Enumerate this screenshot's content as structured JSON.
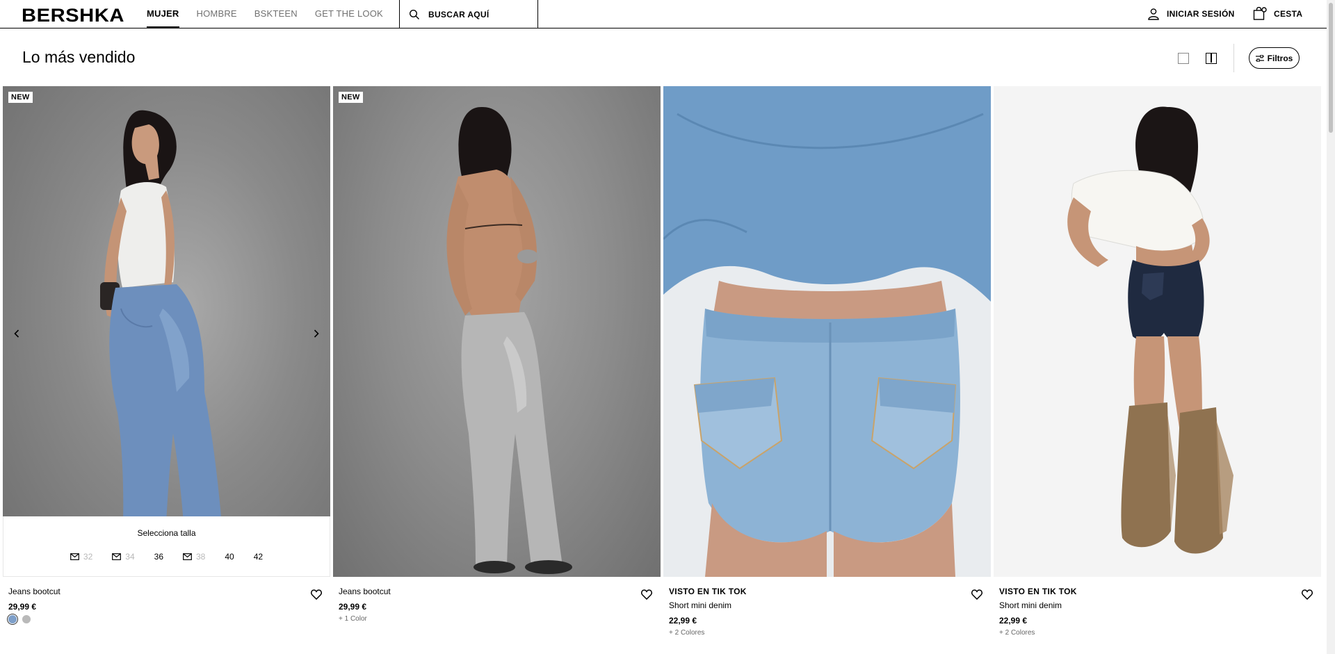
{
  "header": {
    "logo": "BERSHKA",
    "nav": [
      "MUJER",
      "HOMBRE",
      "BSKTEEN",
      "GET THE LOOK"
    ],
    "search_placeholder": "BUSCAR AQUÍ",
    "login": "INICIAR SESIÓN",
    "cart": "CESTA"
  },
  "page": {
    "title": "Lo más vendido",
    "filter_label": "Filtros"
  },
  "products": [
    {
      "badge": "NEW",
      "name": "Jeans bootcut",
      "price": "29,99 €",
      "size_prompt": "Selecciona talla",
      "sizes": [
        {
          "label": "32",
          "available": false
        },
        {
          "label": "34",
          "available": false
        },
        {
          "label": "36",
          "available": true
        },
        {
          "label": "38",
          "available": false
        },
        {
          "label": "40",
          "available": true
        },
        {
          "label": "42",
          "available": true
        }
      ],
      "swatches": [
        "#7e9fc9",
        "#b9b9b9"
      ]
    },
    {
      "badge": "NEW",
      "name": "Jeans bootcut",
      "price": "29,99 €",
      "more_colors": "+ 1 Color"
    },
    {
      "promo": "VISTO EN TIK TOK",
      "name": "Short mini denim",
      "price": "22,99 €",
      "more_colors": "+ 2 Colores"
    },
    {
      "promo": "VISTO EN TIK TOK",
      "name": "Short mini denim",
      "price": "22,99 €",
      "more_colors": "+ 2 Colores"
    }
  ],
  "icons": {
    "search": "search-icon",
    "user": "user-icon",
    "cart": "shopping-bag-icon",
    "filter": "sliders-icon",
    "heart": "heart-icon",
    "prev": "chevron-left-icon",
    "next": "chevron-right-icon",
    "mail": "mail-icon"
  }
}
